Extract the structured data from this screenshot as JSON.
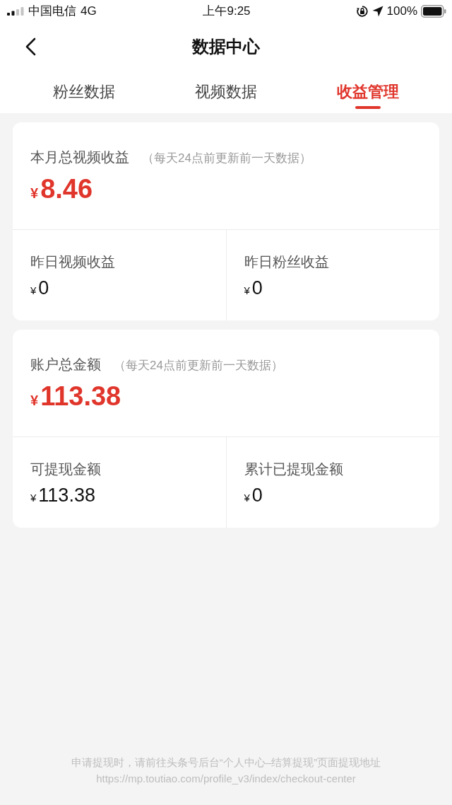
{
  "status_bar": {
    "carrier": "中国电信",
    "network": "4G",
    "time": "上午9:25",
    "battery": "100%"
  },
  "header": {
    "title": "数据中心"
  },
  "tabs": [
    {
      "label": "粉丝数据",
      "selected": false
    },
    {
      "label": "视频数据",
      "selected": false
    },
    {
      "label": "收益管理",
      "selected": true
    }
  ],
  "cards": [
    {
      "summary": {
        "label": "本月总视频收益",
        "note": "（每天24点前更新前一天数据）",
        "currency": "¥",
        "amount": "8.46"
      },
      "items": [
        {
          "label": "昨日视频收益",
          "currency": "¥",
          "amount": "0"
        },
        {
          "label": "昨日粉丝收益",
          "currency": "¥",
          "amount": "0"
        }
      ]
    },
    {
      "summary": {
        "label": "账户总金额",
        "note": "（每天24点前更新前一天数据）",
        "currency": "¥",
        "amount": "113.38"
      },
      "items": [
        {
          "label": "可提现金额",
          "currency": "¥",
          "amount": "113.38"
        },
        {
          "label": "累计已提现金额",
          "currency": "¥",
          "amount": "0"
        }
      ]
    }
  ],
  "footer": {
    "lines": [
      "申请提现时，请前往头条号后台“个人中心–结算提现”页面提现地址",
      "https://mp.toutiao.com/profile_v3/index/checkout-center"
    ]
  }
}
